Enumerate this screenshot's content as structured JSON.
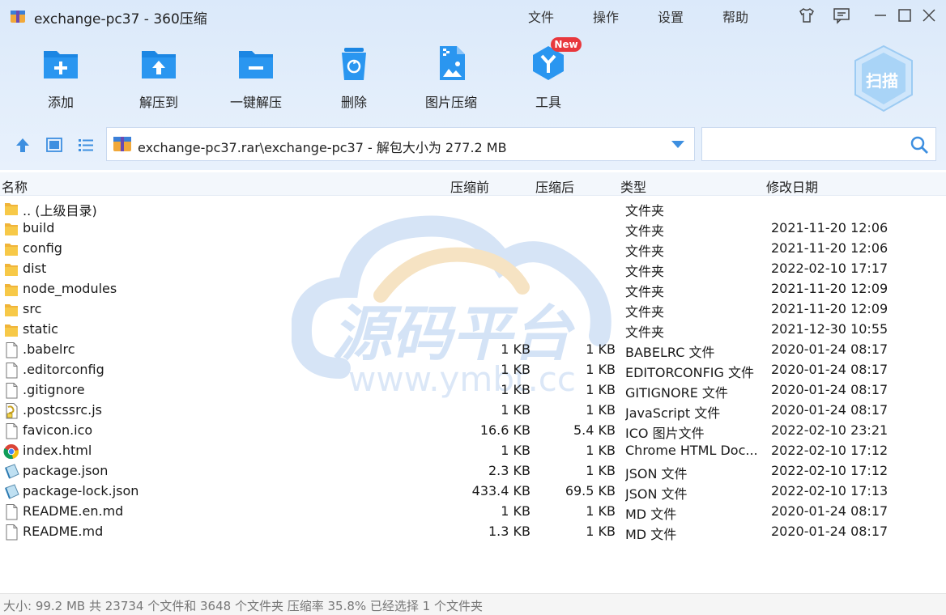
{
  "window": {
    "title": "exchange-pc37 - 360压缩",
    "menus": [
      "文件",
      "操作",
      "设置",
      "帮助"
    ]
  },
  "toolbar": {
    "buttons": [
      {
        "label": "添加",
        "icon": "add-icon"
      },
      {
        "label": "解压到",
        "icon": "extract-to-icon"
      },
      {
        "label": "一键解压",
        "icon": "one-click-extract-icon"
      },
      {
        "label": "删除",
        "icon": "delete-icon"
      },
      {
        "label": "图片压缩",
        "icon": "image-compress-icon"
      },
      {
        "label": "工具",
        "icon": "tools-icon"
      }
    ],
    "new_badge": "New",
    "scan_label": "扫描"
  },
  "address": {
    "path": "exchange-pc37.rar\\exchange-pc37 - 解包大小为 277.2 MB",
    "search_placeholder": ""
  },
  "columns": {
    "name": "名称",
    "before": "压缩前",
    "after": "压缩后",
    "type": "类型",
    "date": "修改日期"
  },
  "files": [
    {
      "name": ".. (上级目录)",
      "before": "",
      "after": "",
      "type": "文件夹",
      "date": "",
      "icon": "folder-icon"
    },
    {
      "name": "build",
      "before": "",
      "after": "",
      "type": "文件夹",
      "date": "2021-11-20 12:06",
      "icon": "folder-icon"
    },
    {
      "name": "config",
      "before": "",
      "after": "",
      "type": "文件夹",
      "date": "2021-11-20 12:06",
      "icon": "folder-icon"
    },
    {
      "name": "dist",
      "before": "",
      "after": "",
      "type": "文件夹",
      "date": "2022-02-10 17:17",
      "icon": "folder-icon"
    },
    {
      "name": "node_modules",
      "before": "",
      "after": "",
      "type": "文件夹",
      "date": "2021-11-20 12:09",
      "icon": "folder-icon"
    },
    {
      "name": "src",
      "before": "",
      "after": "",
      "type": "文件夹",
      "date": "2021-11-20 12:09",
      "icon": "folder-icon"
    },
    {
      "name": "static",
      "before": "",
      "after": "",
      "type": "文件夹",
      "date": "2021-12-30 10:55",
      "icon": "folder-icon"
    },
    {
      "name": ".babelrc",
      "before": "1 KB",
      "after": "1 KB",
      "type": "BABELRC 文件",
      "date": "2020-01-24 08:17",
      "icon": "file-icon"
    },
    {
      "name": ".editorconfig",
      "before": "1 KB",
      "after": "1 KB",
      "type": "EDITORCONFIG 文件",
      "date": "2020-01-24 08:17",
      "icon": "file-icon"
    },
    {
      "name": ".gitignore",
      "before": "1 KB",
      "after": "1 KB",
      "type": "GITIGNORE 文件",
      "date": "2020-01-24 08:17",
      "icon": "file-icon"
    },
    {
      "name": ".postcssrc.js",
      "before": "1 KB",
      "after": "1 KB",
      "type": "JavaScript 文件",
      "date": "2020-01-24 08:17",
      "icon": "script-file-icon"
    },
    {
      "name": "favicon.ico",
      "before": "16.6 KB",
      "after": "5.4 KB",
      "type": "ICO 图片文件",
      "date": "2022-02-10 23:21",
      "icon": "file-icon"
    },
    {
      "name": "index.html",
      "before": "1 KB",
      "after": "1 KB",
      "type": "Chrome HTML Doc...",
      "date": "2022-02-10 17:12",
      "icon": "chrome-icon"
    },
    {
      "name": "package.json",
      "before": "2.3 KB",
      "after": "1 KB",
      "type": "JSON 文件",
      "date": "2022-02-10 17:12",
      "icon": "json-file-icon"
    },
    {
      "name": "package-lock.json",
      "before": "433.4 KB",
      "after": "69.5 KB",
      "type": "JSON 文件",
      "date": "2022-02-10 17:13",
      "icon": "json-file-icon"
    },
    {
      "name": "README.en.md",
      "before": "1 KB",
      "after": "1 KB",
      "type": "MD 文件",
      "date": "2020-01-24 08:17",
      "icon": "file-icon"
    },
    {
      "name": "README.md",
      "before": "1.3 KB",
      "after": "1 KB",
      "type": "MD 文件",
      "date": "2020-01-24 08:17",
      "icon": "file-icon"
    }
  ],
  "watermark": {
    "text": "源码平台",
    "url": "www.ymbt.cc"
  },
  "status": {
    "text": "大小: 99.2 MB 共 23734 个文件和 3648 个文件夹 压缩率 35.8% 已经选择 1 个文件夹"
  },
  "colors": {
    "accent": "#1e90e6",
    "toolbar_bg": "#dfecfa",
    "folder": "#f5c342"
  }
}
